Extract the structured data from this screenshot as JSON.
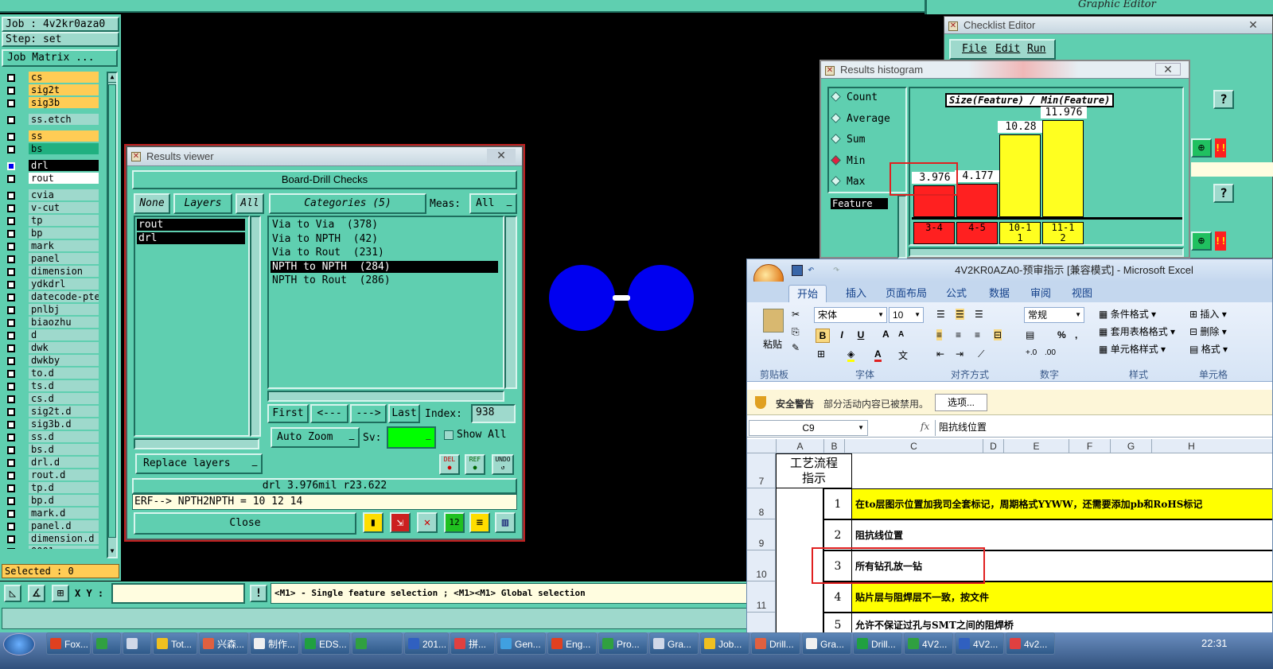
{
  "job": {
    "job_label": "Job : 4v2kr0aza0",
    "step_label": "Step: set",
    "matrix_button": "Job Matrix ...",
    "selected": "Selected : 0"
  },
  "layers": [
    {
      "name": "cs",
      "color": "#ffcc55"
    },
    {
      "name": "sig2t",
      "color": "#ffcc55"
    },
    {
      "name": "sig3b",
      "color": "#ffcc55"
    },
    {
      "name": "ss.etch",
      "color": "#9ed9cc"
    },
    {
      "name": "ss",
      "color": "#ffcc55"
    },
    {
      "name": "bs",
      "color": "#20b080"
    },
    {
      "name": "drl",
      "color": "#ffffff",
      "active": true
    },
    {
      "name": "rout",
      "color": "#ffffff"
    },
    {
      "name": "cvia",
      "color": "#9ed9cc"
    },
    {
      "name": "v-cut",
      "color": "#9ed9cc"
    },
    {
      "name": "tp",
      "color": "#9ed9cc"
    },
    {
      "name": "bp",
      "color": "#9ed9cc"
    },
    {
      "name": "mark",
      "color": "#9ed9cc"
    },
    {
      "name": "panel",
      "color": "#9ed9cc"
    },
    {
      "name": "dimension",
      "color": "#9ed9cc"
    },
    {
      "name": "ydkdrl",
      "color": "#9ed9cc"
    },
    {
      "name": "datecode-pte",
      "color": "#9ed9cc"
    },
    {
      "name": "pnlbj",
      "color": "#9ed9cc"
    },
    {
      "name": "biaozhu",
      "color": "#9ed9cc"
    },
    {
      "name": "d",
      "color": "#9ed9cc"
    },
    {
      "name": "dwk",
      "color": "#9ed9cc"
    },
    {
      "name": "dwkby",
      "color": "#9ed9cc"
    },
    {
      "name": "to.d",
      "color": "#9ed9cc"
    },
    {
      "name": "ts.d",
      "color": "#9ed9cc"
    },
    {
      "name": "cs.d",
      "color": "#9ed9cc"
    },
    {
      "name": "sig2t.d",
      "color": "#9ed9cc"
    },
    {
      "name": "sig3b.d",
      "color": "#9ed9cc"
    },
    {
      "name": "ss.d",
      "color": "#9ed9cc"
    },
    {
      "name": "bs.d",
      "color": "#9ed9cc"
    },
    {
      "name": "drl.d",
      "color": "#9ed9cc"
    },
    {
      "name": "rout.d",
      "color": "#9ed9cc"
    },
    {
      "name": "tp.d",
      "color": "#9ed9cc"
    },
    {
      "name": "bp.d",
      "color": "#9ed9cc"
    },
    {
      "name": "mark.d",
      "color": "#9ed9cc"
    },
    {
      "name": "panel.d",
      "color": "#9ed9cc"
    },
    {
      "name": "dimension.d",
      "color": "#9ed9cc"
    },
    {
      "name": "0001",
      "color": "#9ed9cc"
    }
  ],
  "results": {
    "title": "Results viewer",
    "close_x": "✕",
    "header": "Board-Drill Checks",
    "none_btn": "None",
    "layers_btn": "Layers",
    "all_btn": "All",
    "categories_btn": "Categories (5)",
    "meas_label": "Meas:",
    "meas_value": "All",
    "layer_items": [
      "rout",
      "drl"
    ],
    "categories": [
      "Via to Via  (378)",
      "Via to NPTH  (42)",
      "Via to Rout  (231)",
      "NPTH to NPTH  (284)",
      "NPTH to Rout  (286)"
    ],
    "selected_category": 3,
    "first": "First",
    "prev": "<---",
    "next": "--->",
    "last": "Last",
    "index_label": "Index:",
    "index_value": "938",
    "auto_zoom": "Auto Zoom",
    "sv_label": "Sv:",
    "show_all": "Show All",
    "replace_layers": "Replace layers",
    "del": "DEL",
    "ref": "REF",
    "undo": "UNDO",
    "info": "drl 3.976mil  r23.622",
    "erf": "ERF--> NPTH2NPTH = 10 12 14",
    "close": "Close"
  },
  "histogram": {
    "title": "Results histogram",
    "close": "✕",
    "options": [
      "Count",
      "Average",
      "Sum",
      "Min",
      "Max"
    ],
    "selected_option": "Min",
    "feature_label": "Feature",
    "plot_title": "Size(Feature) / Min(Feature)"
  },
  "chart_data": {
    "type": "bar",
    "title": "Size(Feature) / Min(Feature)",
    "categories": [
      "3-4",
      "4-5",
      "10-11",
      "11-12"
    ],
    "values": [
      3.976,
      4.177,
      10.28,
      11.976
    ],
    "colors": [
      "#ff2020",
      "#ff2020",
      "#ffff20",
      "#ffff20"
    ],
    "ylim": [
      0,
      13
    ]
  },
  "checklist": {
    "title": "Checklist Editor",
    "menu": [
      "File",
      "Edit",
      "Run"
    ],
    "close": "✕"
  },
  "brand": {
    "subtitle": "Graphic Editor"
  },
  "xy": {
    "label": "X Y :",
    "value": "",
    "help": "<M1> - Single feature selection ; <M1><M1> Global selection"
  },
  "excel": {
    "title": "4V2KR0AZA0-预审指示  [兼容模式] - Microsoft Excel",
    "tabs": [
      "开始",
      "插入",
      "页面布局",
      "公式",
      "数据",
      "审阅",
      "视图"
    ],
    "paste": "粘贴",
    "clipboard": "剪贴板",
    "font_name": "宋体",
    "font_size": "10",
    "font_group": "字体",
    "align_group": "对齐方式",
    "number_format": "常规",
    "number_group": "数字",
    "styles": [
      "条件格式",
      "套用表格格式",
      "单元格样式"
    ],
    "styles_group": "样式",
    "cells": [
      "插入",
      "删除",
      "格式"
    ],
    "cells_group": "单元格",
    "security_title": "安全警告",
    "security_msg": "部分活动内容已被禁用。",
    "options_btn": "选项...",
    "cell_ref": "C9",
    "fx": "fx",
    "formula": "阻抗线位置",
    "columns": [
      "A",
      "B",
      "C",
      "D",
      "E",
      "F",
      "G",
      "H"
    ],
    "header_cell": "工艺流程指示",
    "rows": [
      {
        "num": "7",
        "b": "",
        "c": ""
      },
      {
        "num": "8",
        "b": "1",
        "c": "在to层图示位置加我司全套标记，周期格式YYWW，还需要添加pb和RoHS标记",
        "yellow": true
      },
      {
        "num": "9",
        "b": "2",
        "c": "阻抗线位置"
      },
      {
        "num": "10",
        "b": "3",
        "c": "所有钻孔放一钻"
      },
      {
        "num": "11",
        "b": "4",
        "c": "贴片层与阻焊层不一致，按文件",
        "yellow": true
      },
      {
        "num": "",
        "b": "5",
        "c": "允许不保证过孔与SMT之间的阻焊桥"
      }
    ]
  },
  "taskbar": {
    "items": [
      "Fox...",
      "",
      "",
      "Tot...",
      "兴森...",
      "制作...",
      "EDS...",
      "",
      "201...",
      "拼...",
      "Gen...",
      "Eng...",
      "Pro...",
      "Gra...",
      "Job...",
      "Drill...",
      "Gra...",
      "Drill...",
      "4V2...",
      "4V2...",
      "4v2..."
    ],
    "time": "22:31"
  }
}
